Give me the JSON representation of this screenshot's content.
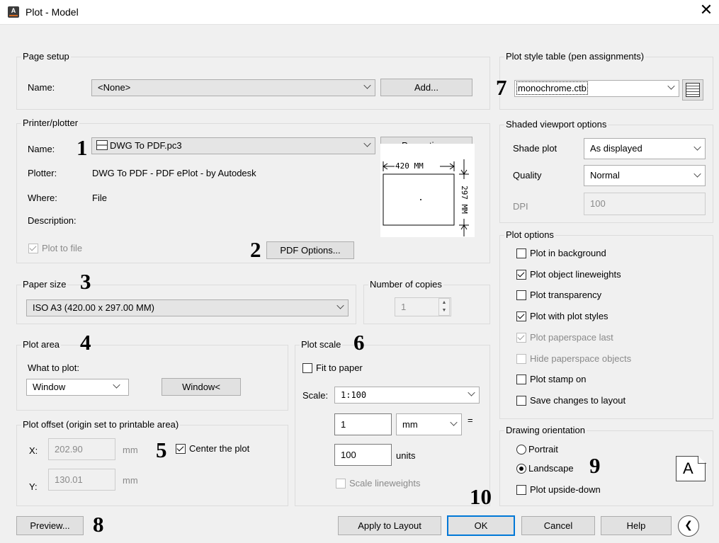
{
  "window": {
    "title": "Plot - Model",
    "close_glyph": "✕",
    "app_icon": "autocad-icon"
  },
  "page_setup": {
    "legend": "Page setup",
    "name_label": "Name:",
    "name_value": "<None>",
    "add_button": "Add..."
  },
  "printer": {
    "legend": "Printer/plotter",
    "name_label": "Name:",
    "name_value": "DWG To PDF.pc3",
    "properties_button": "Properties...",
    "plotter_label": "Plotter:",
    "plotter_value": "DWG To PDF - PDF ePlot - by Autodesk",
    "where_label": "Where:",
    "where_value": "File",
    "description_label": "Description:",
    "plot_to_file_label": "Plot to file",
    "plot_to_file_checked": true,
    "pdf_options_button": "PDF Options...",
    "preview_width_label": "420 MM",
    "preview_height_label": "297 MM"
  },
  "paper_size": {
    "legend": "Paper size",
    "value": "ISO A3 (420.00 x 297.00 MM)"
  },
  "copies": {
    "legend": "Number of copies",
    "value": "1"
  },
  "plot_area": {
    "legend": "Plot area",
    "what_label": "What to plot:",
    "what_value": "Window",
    "window_button": "Window<"
  },
  "plot_offset": {
    "legend": "Plot offset (origin set to printable area)",
    "x_label": "X:",
    "x_value": "202.90",
    "x_unit": "mm",
    "y_label": "Y:",
    "y_value": "130.01",
    "y_unit": "mm",
    "center_label": "Center the plot",
    "center_checked": true
  },
  "plot_scale": {
    "legend": "Plot scale",
    "fit_label": "Fit to paper",
    "fit_checked": false,
    "scale_label": "Scale:",
    "scale_value": "1:100",
    "value1": "1",
    "unit1": "mm",
    "equals": "=",
    "value2": "100",
    "unit2": "units",
    "lineweights_label": "Scale lineweights"
  },
  "plot_style": {
    "legend": "Plot style table (pen assignments)",
    "value": "monochrome.ctb"
  },
  "shaded": {
    "legend": "Shaded viewport options",
    "shade_label": "Shade plot",
    "shade_value": "As displayed",
    "quality_label": "Quality",
    "quality_value": "Normal",
    "dpi_label": "DPI",
    "dpi_value": "100"
  },
  "plot_options": {
    "legend": "Plot options",
    "items": [
      {
        "label": "Plot in background",
        "checked": false,
        "disabled": false
      },
      {
        "label": "Plot object lineweights",
        "checked": true,
        "disabled": false
      },
      {
        "label": "Plot transparency",
        "checked": false,
        "disabled": false
      },
      {
        "label": "Plot with plot styles",
        "checked": true,
        "disabled": false
      },
      {
        "label": "Plot paperspace last",
        "checked": true,
        "disabled": true
      },
      {
        "label": "Hide paperspace objects",
        "checked": false,
        "disabled": true
      },
      {
        "label": "Plot stamp on",
        "checked": false,
        "disabled": false
      },
      {
        "label": "Save changes to layout",
        "checked": false,
        "disabled": false
      }
    ]
  },
  "orientation": {
    "legend": "Drawing orientation",
    "portrait_label": "Portrait",
    "landscape_label": "Landscape",
    "selected": "Landscape",
    "upside_down_label": "Plot upside-down",
    "orientation_icon_letter": "A"
  },
  "footer": {
    "preview_button": "Preview...",
    "apply_button": "Apply to Layout",
    "ok_button": "OK",
    "cancel_button": "Cancel",
    "help_button": "Help",
    "expand_glyph": "❮"
  },
  "markers": {
    "m1": "1",
    "m2": "2",
    "m3": "3",
    "m4": "4",
    "m5": "5",
    "m6": "6",
    "m7": "7",
    "m8": "8",
    "m9": "9",
    "m10": "10"
  },
  "colors": {
    "accent": "#0078d7",
    "dialog_bg": "#f0f0f0"
  }
}
